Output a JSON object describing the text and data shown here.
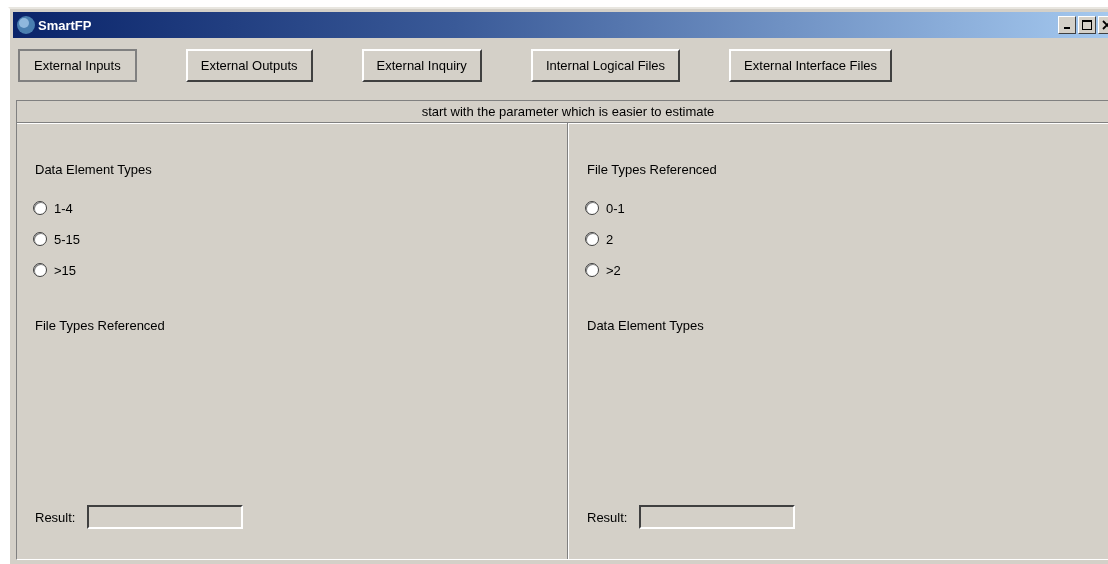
{
  "window": {
    "title": "SmartFP"
  },
  "tabs": [
    {
      "label": "External Inputs",
      "selected": true
    },
    {
      "label": "External Outputs",
      "selected": false
    },
    {
      "label": "External Inquiry",
      "selected": false
    },
    {
      "label": "Internal Logical Files",
      "selected": false
    },
    {
      "label": "External Interface Files",
      "selected": false
    }
  ],
  "hint": "start with the parameter which is easier to estimate",
  "panels": [
    {
      "heading": "Data Element Types",
      "options": [
        {
          "label": "1-4",
          "selected": false
        },
        {
          "label": "5-15",
          "selected": false
        },
        {
          "label": ">15",
          "selected": false
        }
      ],
      "second_heading": "File Types Referenced",
      "result_label": "Result:"
    },
    {
      "heading": "File Types Referenced",
      "options": [
        {
          "label": "0-1",
          "selected": false
        },
        {
          "label": "2",
          "selected": false
        },
        {
          "label": ">2",
          "selected": false
        }
      ],
      "second_heading": "Data Element Types",
      "result_label": "Result:"
    }
  ]
}
